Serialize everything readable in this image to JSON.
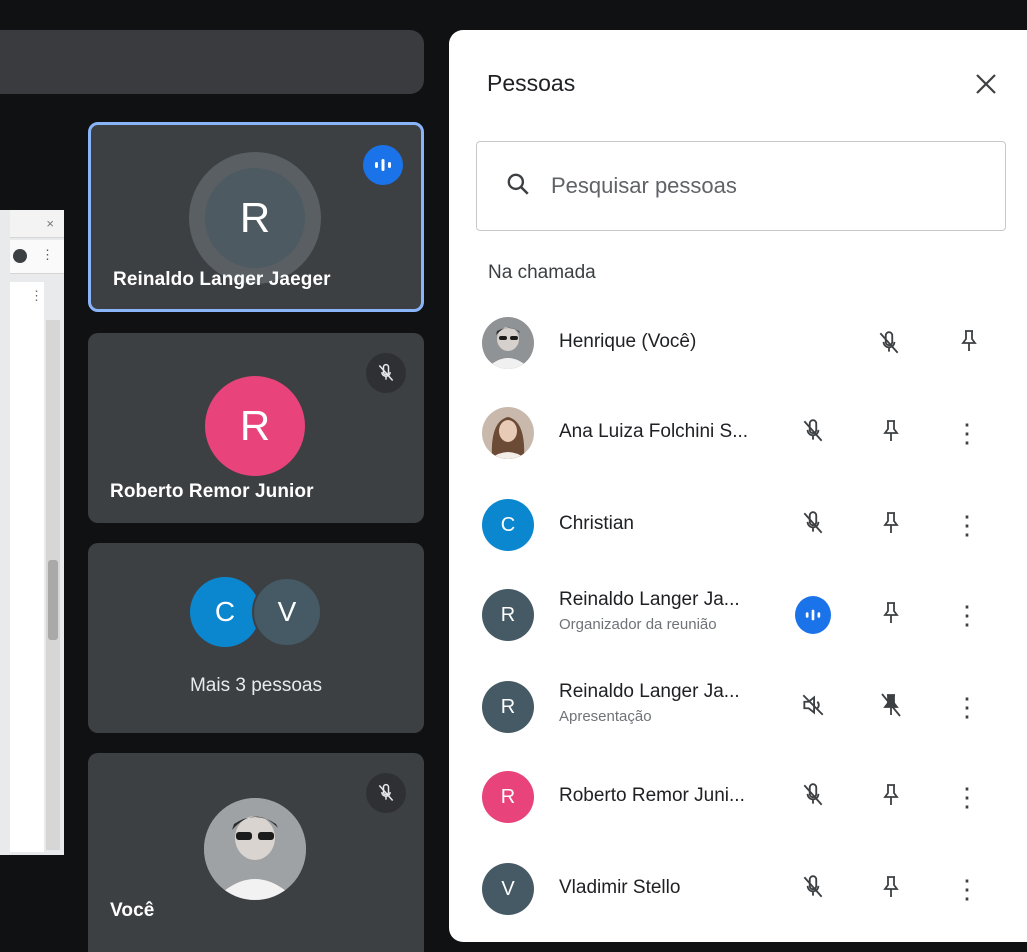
{
  "tiles": [
    {
      "name": "Reinaldo Langer Jaeger",
      "initial": "R",
      "color": "#4d5a61",
      "status": "speaking"
    },
    {
      "name": "Roberto Remor Junior",
      "initial": "R",
      "color": "#e8437a",
      "status": "muted"
    },
    {
      "label": "Mais 3 pessoas",
      "initials": [
        "C",
        "V"
      ],
      "colors": [
        "#0b87d0",
        "#455a64"
      ]
    },
    {
      "name": "Você",
      "status": "muted"
    }
  ],
  "panel": {
    "title": "Pessoas",
    "search_placeholder": "Pesquisar pessoas",
    "section": "Na chamada",
    "people": [
      {
        "name": "Henrique (Você)",
        "avatar": "photo-man"
      },
      {
        "name": "Ana Luiza Folchini S...",
        "avatar": "photo-woman"
      },
      {
        "name": "Christian",
        "initial": "C",
        "color": "#0b87d0"
      },
      {
        "name": "Reinaldo Langer Ja...",
        "subtitle": "Organizador da reunião",
        "initial": "R",
        "color": "#455a64",
        "status": "speaking"
      },
      {
        "name": "Reinaldo Langer Ja...",
        "subtitle": "Apresentação",
        "initial": "R",
        "color": "#455a64",
        "status": "presentation"
      },
      {
        "name": "Roberto Remor Juni...",
        "initial": "R",
        "color": "#e8437a"
      },
      {
        "name": "Vladimir Stello",
        "initial": "V",
        "color": "#455a64"
      }
    ]
  },
  "colors": {
    "accent": "#1a73e8",
    "tile": "#3c4043",
    "active_border": "#8ab4f8"
  }
}
